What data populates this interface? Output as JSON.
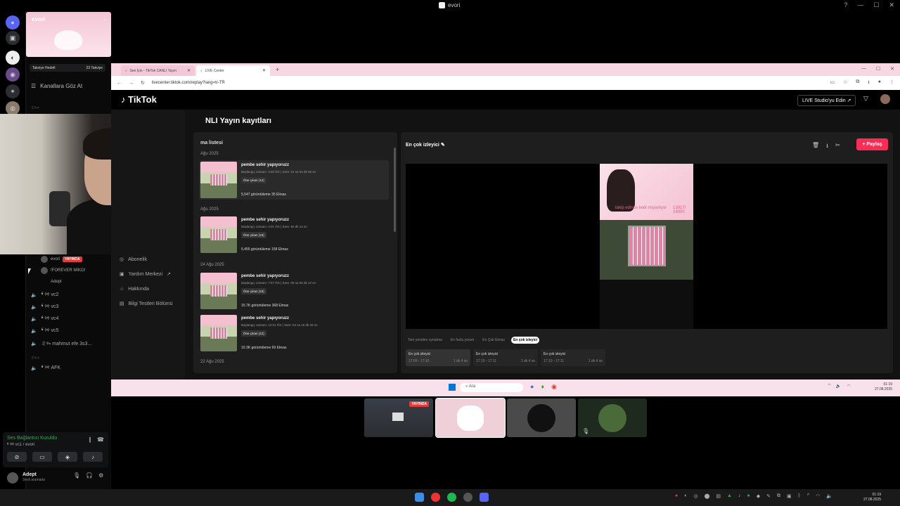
{
  "window": {
    "title": "evori"
  },
  "discord": {
    "server_name": "evori",
    "boost": {
      "label": "Takviye Hedefi",
      "count": "23 Takviye"
    },
    "browse_label": "Kanallara Göz At",
    "category_top": "ミ୨⭑ৎ",
    "voice_users": [
      {
        "name": "evori",
        "badge": "YAYINDA"
      },
      {
        "name": "!FOREVER MİKO!"
      },
      {
        "name": "Adept"
      }
    ],
    "voice_channels": [
      "❛ ୨୧ vc2",
      "❛ ୨୧ vc3",
      "❛ ୨୧ vc4",
      "❛ ୨୧ vc5",
      "ミ୨⭑ mahmut efe 3s3..."
    ],
    "category_bottom": "ミ୨⭑ৎ",
    "afk_channel": "❛ ୨୧ AFK",
    "voice_status": "Ses Bağlantısı Kuruldu",
    "voice_sub": "❛ ୨୧ vc1 / evori",
    "user": {
      "name": "Adept",
      "status": "Sesli aramada"
    }
  },
  "browser": {
    "tabs": [
      {
        "label": "Sen İçin - TikTok CANLI Yayın"
      },
      {
        "label": "LIVE Center"
      }
    ],
    "url": "livecenter.tiktok.com/replay?lang=tr-TR"
  },
  "tiktok": {
    "logo": "TikTok",
    "studio_button": "LIVE Studio'yu Edin ↗",
    "nav": [
      "Abonelik",
      "Yardım Merkezi",
      "Hakkında",
      "Bilgi Testleri Bölümü"
    ],
    "page_title": "NLI Yayın kayıtları",
    "list_title": "ma listesi",
    "items": [
      {
        "date": "Ağu 2025",
        "title": "pembe sehir yapıyoruzz",
        "meta": "Başlangıç zamanı: 4:50 ÖS | Süre: 01 sa 04 dk 09 sn",
        "badge": "Öne çıkan (12)",
        "views": "5,547 görüntüleme  35 Elmas"
      },
      {
        "date": "Ağu 2025",
        "title": "pembe sehir yapıyoruzz",
        "meta": "Başlangıç zamanı: 3:01 ÖS | Süre: 56 dk 14 sn",
        "badge": "Öne çıkan (15)",
        "views": "5,455 görüntüleme  158 Elmas"
      },
      {
        "date": "24 Ağu 2025",
        "title": "pembe sehir yapıyoruzz",
        "meta": "Başlangıç zamanı: 7:57 ÖS | Süre: 06 sa 05 dk 12 sn",
        "badge": "Öne çıkan (15)",
        "views": "15.7K görüntüleme  368 Elmas"
      },
      {
        "date": "",
        "title": "pembe sehir yapıyoruzz",
        "meta": "Başlangıç zamanı: 12:51 ÖS | Süre: 04 sa 16 dk 25 sn",
        "badge": "Öne çıkan (12)",
        "views": "10.3K görüntüleme  69 Elmas"
      }
    ],
    "last_date": "22 Ağu 2025",
    "detail_title": "En çok izleyici",
    "share": "+ Paylaş",
    "video_text": "takip edince kedi miyavliyor",
    "video_count": "13917/ 14000",
    "chips": [
      {
        "label": "Tam yeniden oynatma",
        "active": false
      },
      {
        "label": "En fazla yorum",
        "active": false
      },
      {
        "label": "En Çok Elmas",
        "active": false
      },
      {
        "label": "En çok izleyici",
        "active": true
      }
    ],
    "clips": [
      {
        "title": "En çok izleyici",
        "range": "17:09 - 17:10",
        "dur": "1 dk 4 sn"
      },
      {
        "title": "En çok izleyici",
        "range": "17:10 - 17:11",
        "dur": "1 dk 4 sn"
      },
      {
        "title": "En çok izleyici",
        "range": "17:10 - 17:11",
        "dur": "1 dk 4 sn"
      }
    ]
  },
  "win_taskbar": {
    "search": "Ara",
    "time": "01:19",
    "date": "27.08.2025"
  },
  "stream_tiles": {
    "live_badge": "YAYINDA"
  },
  "taskbar": {
    "time": "01:19",
    "date": "27.08.2025"
  },
  "colors": {
    "tiktok_red": "#fe2c55",
    "discord_green": "#3ba55c",
    "pink": "#f8d7e3"
  }
}
